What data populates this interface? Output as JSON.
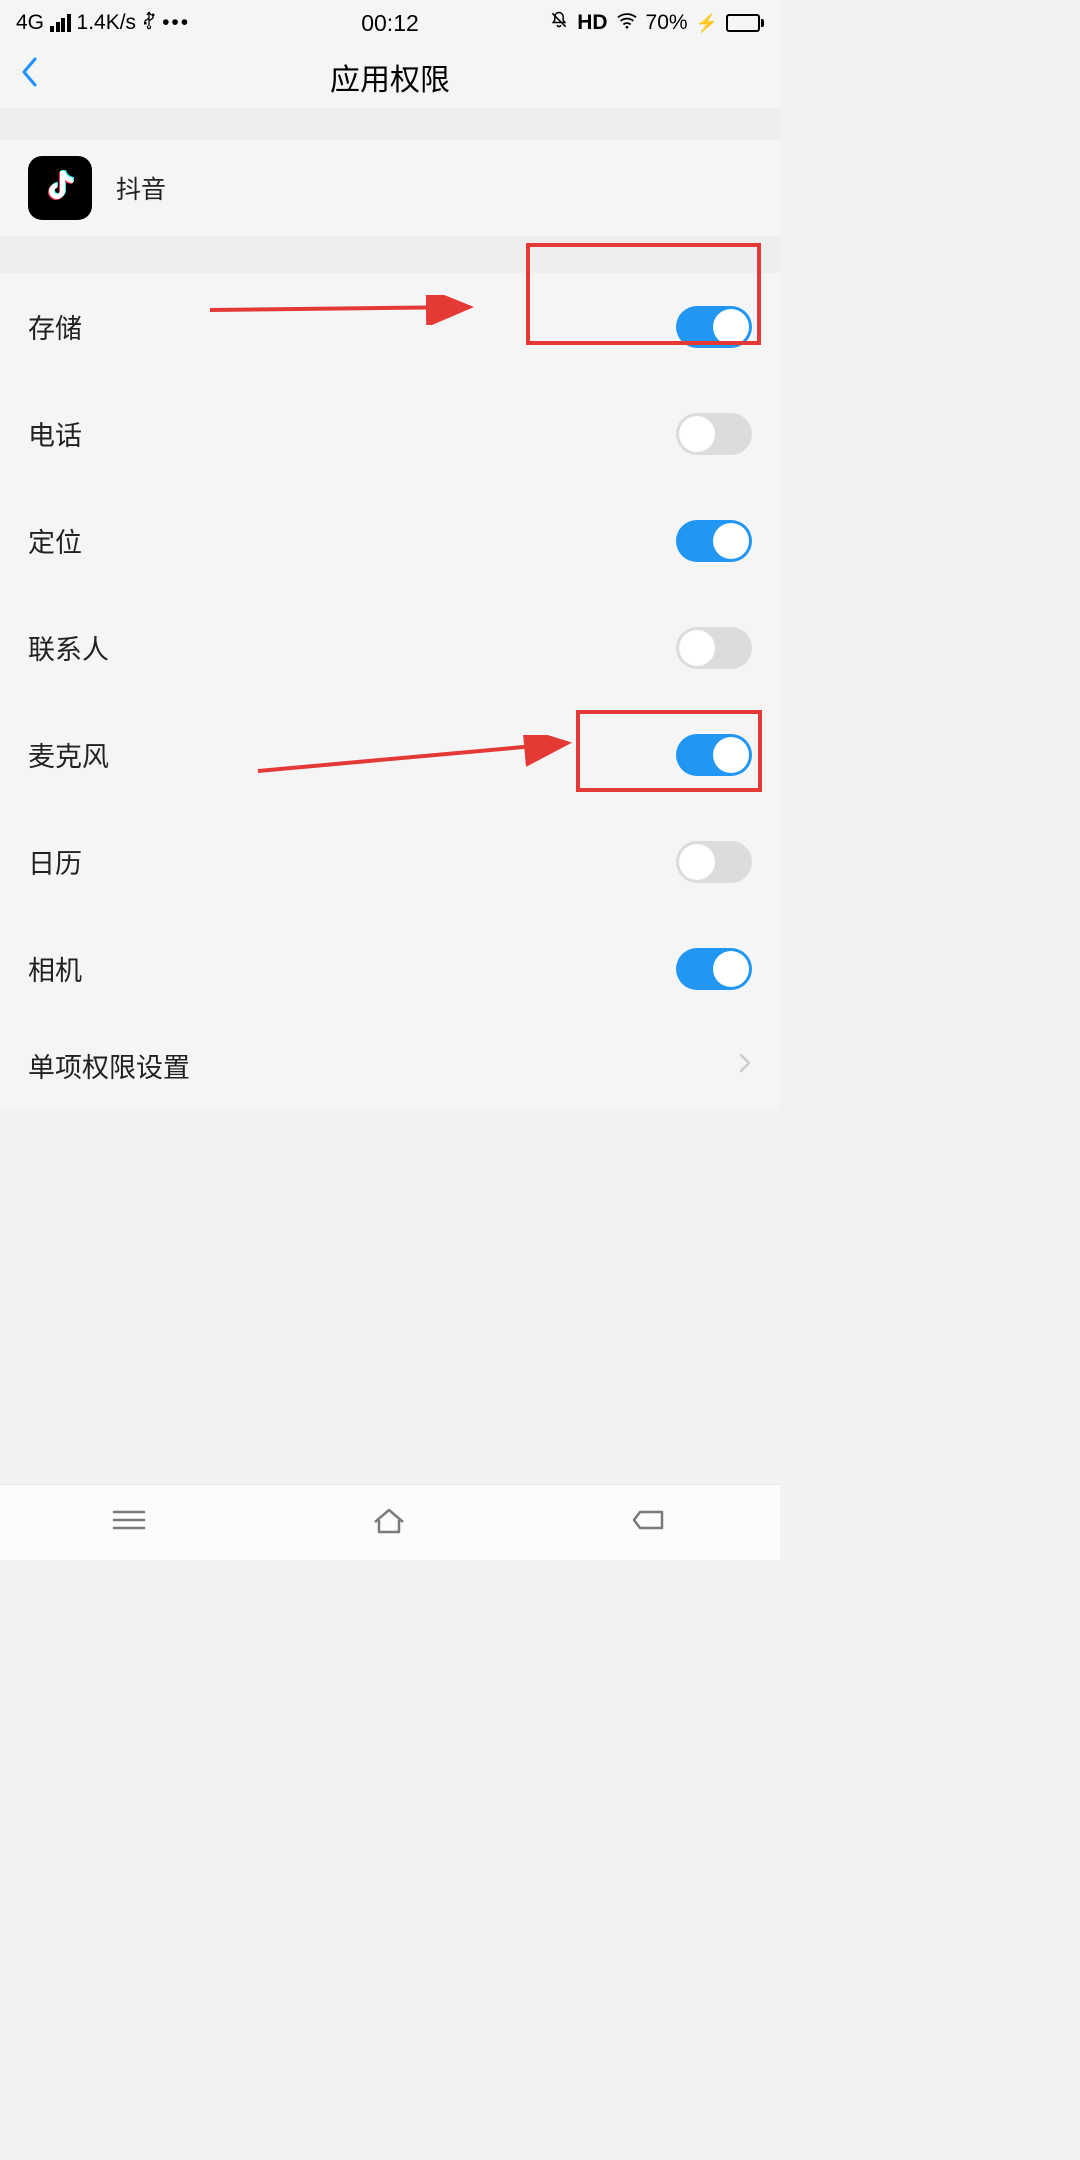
{
  "statusBar": {
    "network": "4G",
    "speed": "1.4K/s",
    "time": "00:12",
    "hd": "HD",
    "battery": "70%"
  },
  "header": {
    "title": "应用权限"
  },
  "app": {
    "name": "抖音"
  },
  "permissions": [
    {
      "label": "存储",
      "on": true
    },
    {
      "label": "电话",
      "on": false
    },
    {
      "label": "定位",
      "on": true
    },
    {
      "label": "联系人",
      "on": false
    },
    {
      "label": "麦克风",
      "on": true
    },
    {
      "label": "日历",
      "on": false
    },
    {
      "label": "相机",
      "on": true
    }
  ],
  "moreSettings": {
    "label": "单项权限设置"
  }
}
